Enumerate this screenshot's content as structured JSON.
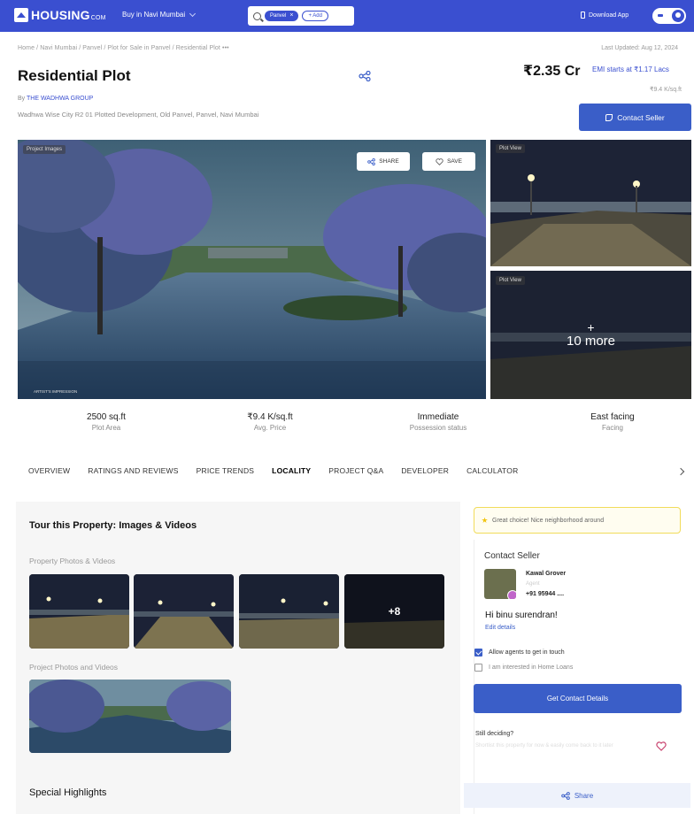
{
  "topbar": {
    "logo": "HOUSING",
    "logo_suffix": "COM",
    "city": "Buy in Navi Mumbai",
    "search_chip": "Panvel",
    "add_chip": "+ Add",
    "download": "Download App",
    "colors": {
      "brand": "#3a4fd0"
    }
  },
  "header": {
    "breadcrumb": "Home / Navi Mumbai / Panvel / Plot for Sale in Panvel / Residential Plot  •••",
    "updated": "Last Updated: Aug 12, 2024",
    "title": "Residential Plot",
    "price": "₹2.35 Cr",
    "emi": "EMI starts at ₹1.17 Lacs",
    "price_sub": "₹9.4 K/sq.ft",
    "by_prefix": "By ",
    "developer": "THE WADHWA GROUP",
    "address": "Wadhwa Wise City R2 01 Plotted Development, Old Panvel, Panvel, Navi Mumbai",
    "contact_button": "Contact Seller"
  },
  "gallery": {
    "main_badge": "Project Images",
    "share_label": "SHARE",
    "save_label": "SAVE",
    "artist_note": "ARTIST'S IMPRESSION",
    "side1_badge": "Plot View",
    "side2_badge": "Plot View",
    "more_plus": "+",
    "more_count": "10 more"
  },
  "stats": [
    {
      "value": "2500 sq.ft",
      "label": "Plot Area"
    },
    {
      "value": "₹9.4 K/sq.ft",
      "label": "Avg. Price"
    },
    {
      "value": "Immediate",
      "label": "Possession status"
    },
    {
      "value": "East facing",
      "label": "Facing"
    }
  ],
  "tabs": [
    "OVERVIEW",
    "RATINGS AND REVIEWS",
    "PRICE TRENDS",
    "LOCALITY",
    "PROJECT Q&A",
    "DEVELOPER",
    "CALCULATOR"
  ],
  "content": {
    "tour_title": "Tour this Property: Images & Videos",
    "property_photos": "Property Photos & Videos",
    "more_thumbs": "+8",
    "project_photos": "Project Photos and Videos",
    "special": "Special Highlights"
  },
  "panel": {
    "great_choice": "Great choice! Nice neighborhood around",
    "contact_seller": "Contact Seller",
    "seller_name": "Kawal Grover",
    "seller_role": "Agent",
    "seller_phone": "+91 95944 ....",
    "greeting": "Hi binu surendran!",
    "edit_details": "Edit details",
    "allow_agents": "Allow agents to get in touch",
    "home_loans": "I am interested in Home Loans",
    "get_details": "Get Contact Details",
    "still_deciding": "Still deciding?",
    "still_sub": "Shortlist this property for now & easily come back to it later",
    "share": "Share"
  }
}
